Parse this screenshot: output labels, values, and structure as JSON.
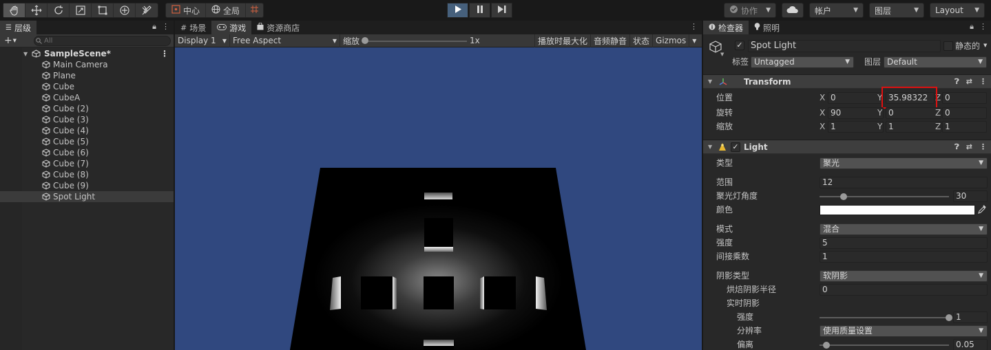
{
  "toolbar": {
    "tools": [
      "hand-tool",
      "move-tool",
      "rotate-tool",
      "scale-tool",
      "rect-tool",
      "transform-tool",
      "custom-tool"
    ],
    "pivot_label": "中心",
    "global_label": "全局",
    "collab_label": "协作",
    "account_label": "帐户",
    "layers_label": "图层",
    "layout_label": "Layout"
  },
  "hierarchy": {
    "tab_label": "层级",
    "search_placeholder": "All",
    "scene_name": "SampleScene*",
    "items": [
      "Main Camera",
      "Plane",
      "Cube",
      "CubeA",
      "Cube (2)",
      "Cube (3)",
      "Cube (4)",
      "Cube (5)",
      "Cube (6)",
      "Cube (7)",
      "Cube (8)",
      "Cube (9)",
      "Spot Light"
    ],
    "selected": "Spot Light"
  },
  "game": {
    "tabs": {
      "scene": "场景",
      "game": "游戏",
      "store": "资源商店"
    },
    "display": "Display 1",
    "aspect": "Free Aspect",
    "scale_label": "缩放",
    "scale_value": "1x",
    "scale_level": 0,
    "maximize_label": "播放时最大化",
    "mute_label": "音频静音",
    "stats_label": "状态",
    "gizmos_label": "Gizmos"
  },
  "inspector": {
    "tabs": {
      "inspector": "检查器",
      "lighting": "照明"
    },
    "object_name": "Spot Light",
    "static_label": "静态的",
    "tag_label": "标签",
    "tag_value": "Untagged",
    "layer_label": "图层",
    "layer_value": "Default",
    "transform": {
      "title": "Transform",
      "position_label": "位置",
      "rotation_label": "旋转",
      "scale_label": "缩放",
      "position": {
        "x": "0",
        "y": "35.98322",
        "z": "0"
      },
      "rotation": {
        "x": "90",
        "y": "0",
        "z": "0"
      },
      "scale": {
        "x": "1",
        "y": "1",
        "z": "1"
      },
      "highlight_color": "#e01010"
    },
    "light": {
      "title": "Light",
      "type_label": "类型",
      "type_value": "聚光",
      "range_label": "范围",
      "range_value": "12",
      "spot_angle_label": "聚光灯角度",
      "spot_angle_value": "30",
      "color_label": "颜色",
      "color_value": "#ffffff",
      "mode_label": "模式",
      "mode_value": "混合",
      "intensity_label": "强度",
      "intensity_value": "5",
      "indirect_label": "间接乘数",
      "indirect_value": "1",
      "shadow_type_label": "阴影类型",
      "shadow_type_value": "软阴影",
      "baked_radius_label": "烘焙阴影半径",
      "baked_radius_value": "0",
      "realtime_label": "实时阴影",
      "strength_label": "强度",
      "strength_value": "1",
      "resolution_label": "分辨率",
      "resolution_value": "使用质量设置",
      "bias_label": "偏离",
      "bias_value": "0.05"
    }
  },
  "colors": {
    "sky": "#30487f",
    "play_active": "#46607c"
  }
}
